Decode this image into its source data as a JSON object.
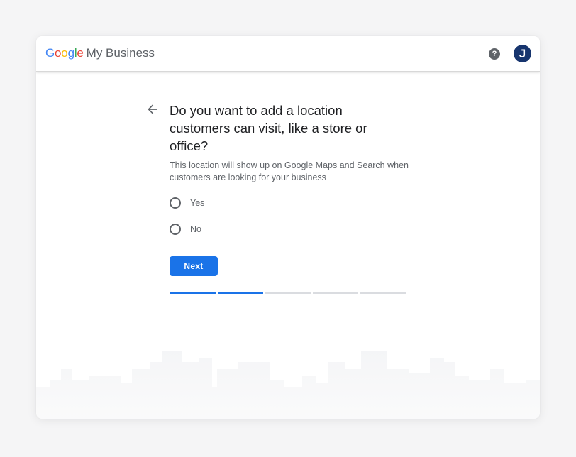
{
  "header": {
    "brand_google": "Google",
    "brand_product": "My Business",
    "help_symbol": "?",
    "avatar_initial": "J"
  },
  "colors": {
    "accent": "#1a73e8",
    "avatar_bg": "#17356e",
    "google_blue": "#4285f4",
    "google_red": "#ea4335",
    "google_yellow": "#fbbc05",
    "google_green": "#34a853"
  },
  "main": {
    "question": "Do you want to add a location customers can visit, like a store or office?",
    "description": "This location will show up on Google Maps and Search when customers are looking for your business",
    "options": [
      {
        "label": "Yes",
        "selected": false
      },
      {
        "label": "No",
        "selected": false
      }
    ],
    "next_label": "Next"
  },
  "progress": {
    "completed_steps": 2,
    "total_steps": 5
  },
  "icons": [
    "help-icon",
    "avatar",
    "back-arrow-icon",
    "skyline-illustration"
  ]
}
